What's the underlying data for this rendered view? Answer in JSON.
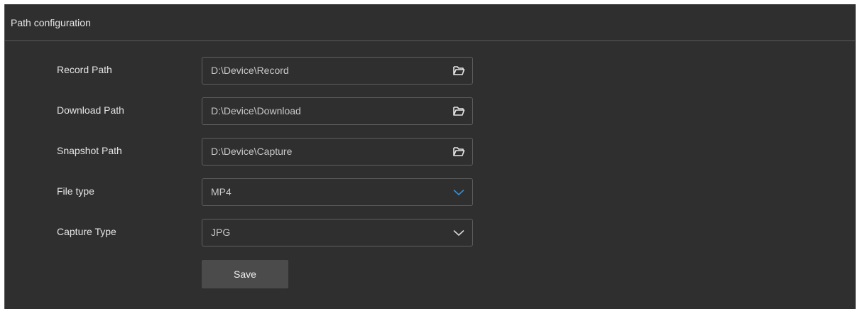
{
  "panel": {
    "title": "Path configuration"
  },
  "fields": [
    {
      "label": "Record Path",
      "value": "D:\\Device\\Record",
      "icon": "folder-icon"
    },
    {
      "label": "Download Path",
      "value": "D:\\Device\\Download",
      "icon": "folder-icon"
    },
    {
      "label": "Snapshot Path",
      "value": "D:\\Device\\Capture",
      "icon": "folder-icon"
    },
    {
      "label": "File type",
      "value": "MP4",
      "icon": "chevron-down-icon",
      "icon_color": "#3a8fd6"
    },
    {
      "label": "Capture Type",
      "value": "JPG",
      "icon": "chevron-down-icon",
      "icon_color": "#d9d9d9"
    }
  ],
  "actions": {
    "save_label": "Save"
  },
  "colors": {
    "panel_bg": "#2f2f2f",
    "text": "#e6e6e6",
    "button_bg": "#4b4b4b"
  }
}
